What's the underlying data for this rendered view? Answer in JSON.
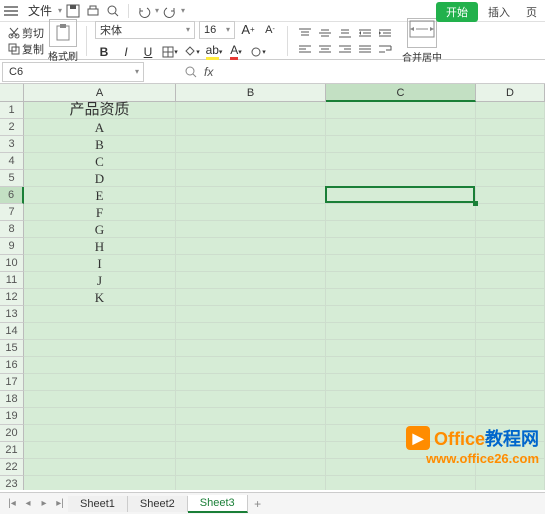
{
  "menu": {
    "file": "文件",
    "tabs": {
      "start": "开始",
      "insert": "插入",
      "page": "页"
    }
  },
  "ribbon": {
    "cut": "剪切",
    "copy": "复制",
    "format_painter": "格式刷",
    "font_name": "宋体",
    "font_size": "16",
    "merge": "合并居中"
  },
  "namebox": {
    "ref": "C6"
  },
  "columns": [
    "A",
    "B",
    "C",
    "D"
  ],
  "rows": [
    "1",
    "2",
    "3",
    "4",
    "5",
    "6",
    "7",
    "8",
    "9",
    "10",
    "11",
    "12",
    "13",
    "14",
    "15",
    "16",
    "17",
    "18",
    "19",
    "20",
    "21",
    "22",
    "23"
  ],
  "cells": {
    "A1": "产品资质",
    "A2": "A",
    "A3": "B",
    "A4": "C",
    "A5": "D",
    "A6": "E",
    "A7": "F",
    "A8": "G",
    "A9": "H",
    "A10": "I",
    "A11": "J",
    "A12": "K"
  },
  "selected": {
    "row": 6,
    "col": "C"
  },
  "sheets": {
    "s1": "Sheet1",
    "s2": "Sheet2",
    "s3": "Sheet3",
    "active": "Sheet3"
  },
  "watermark": {
    "brand_a": "Office",
    "brand_b": "教程网",
    "url": "www.office26.com"
  }
}
